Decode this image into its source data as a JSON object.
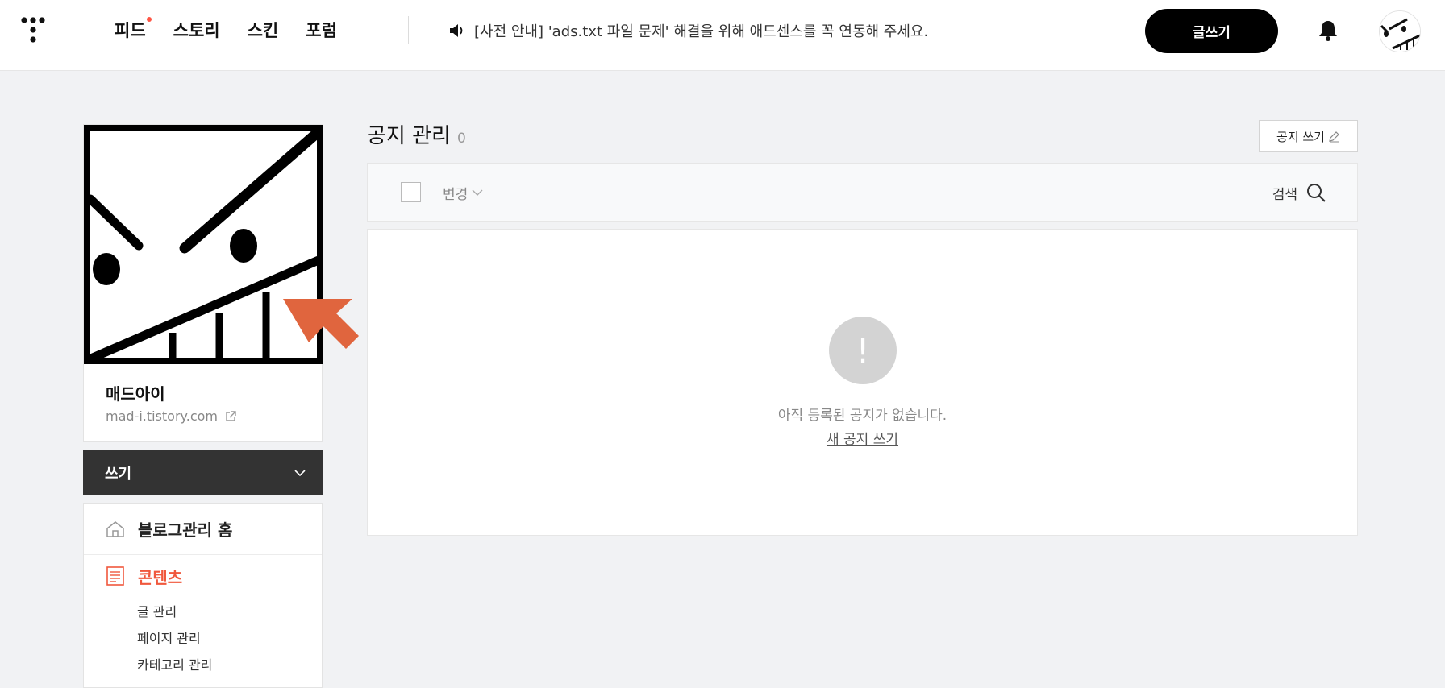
{
  "header": {
    "nav": [
      {
        "label": "피드",
        "has_dot": true
      },
      {
        "label": "스토리",
        "has_dot": false
      },
      {
        "label": "스킨",
        "has_dot": false
      },
      {
        "label": "포럼",
        "has_dot": false
      }
    ],
    "notice_text": "[사전 안내] 'ads.txt 파일 문제' 해결을 위해 애드센스를 꼭 연동해 주세요.",
    "write_label": "글쓰기",
    "icons": {
      "logo": "tistory-logo-icon",
      "notice": "speaker-icon",
      "bell": "bell-icon",
      "avatar": "avatar"
    }
  },
  "profile": {
    "blog_name": "매드아이",
    "blog_url": "mad-i.tistory.com",
    "url_icon": "external-link-icon"
  },
  "write_bar": {
    "label": "쓰기",
    "toggle_icon": "chevron-down-icon"
  },
  "sidebar": {
    "home_label": "블로그관리 홈",
    "home_icon": "home-icon",
    "section_label": "콘텐츠",
    "section_icon": "document-icon",
    "section_color": "#f0583d",
    "items": [
      {
        "label": "글 관리"
      },
      {
        "label": "페이지 관리"
      },
      {
        "label": "카테고리 관리"
      }
    ]
  },
  "main": {
    "title": "공지 관리",
    "count": "0",
    "write_notice_label": "공지 쓰기",
    "write_notice_icon": "pencil-icon",
    "toolbar": {
      "change_label": "변경",
      "search_label": "검색",
      "search_icon": "search-icon"
    },
    "empty": {
      "icon_glyph": "!",
      "message": "아직 등록된 공지가 없습니다.",
      "link_label": "새 공지 쓰기"
    }
  },
  "annotation": {
    "arrow_color": "#e0653e",
    "arrow_icon": "arrow-annotation-icon"
  }
}
